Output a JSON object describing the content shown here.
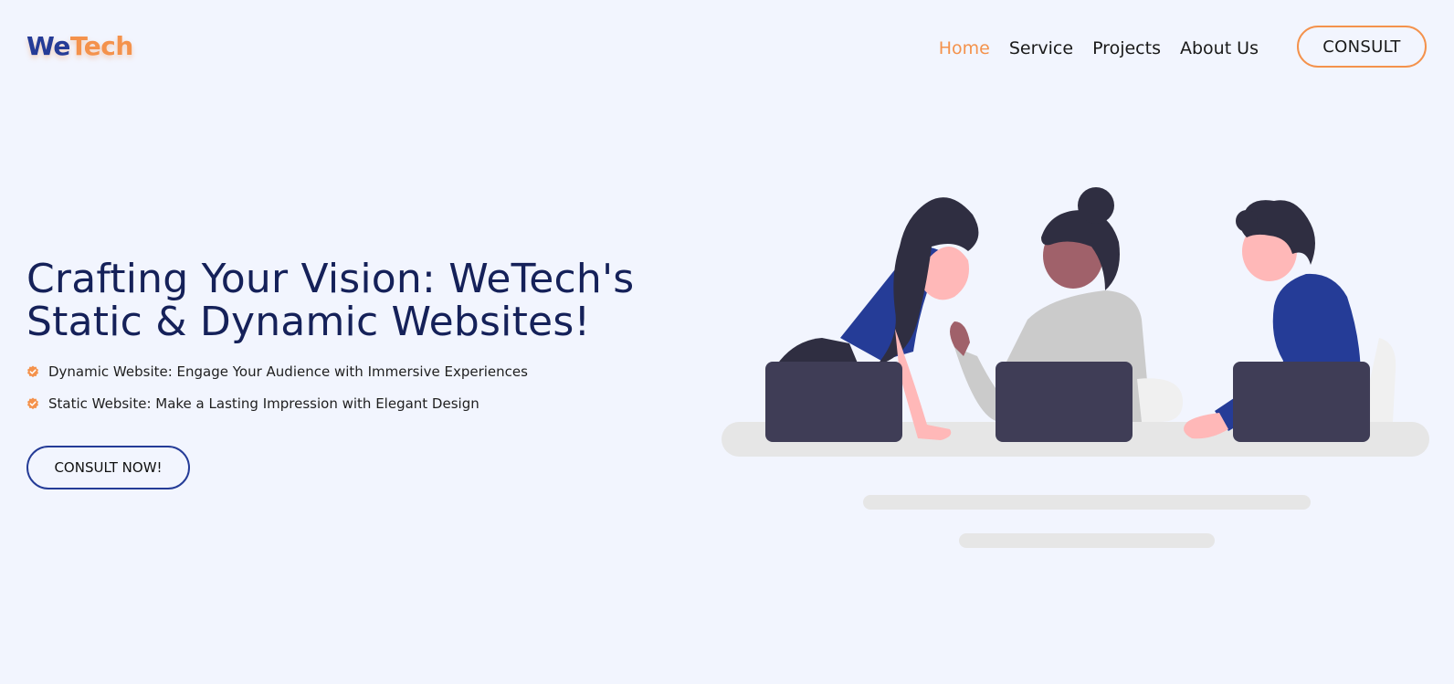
{
  "header": {
    "logo": {
      "part1": "We",
      "part2": "Tech"
    },
    "nav": [
      {
        "label": "Home",
        "active": true
      },
      {
        "label": "Service",
        "active": false
      },
      {
        "label": "Projects",
        "active": false
      },
      {
        "label": "About Us",
        "active": false
      }
    ],
    "cta_label": "CONSULT"
  },
  "hero": {
    "title_line1": "Crafting Your Vision: WeTech's",
    "title_line2": "Static & Dynamic Websites!",
    "features": [
      "Dynamic Website: Engage Your Audience with Immersive Experiences",
      "Static Website: Make a Lasting Impression with Elegant Design"
    ],
    "cta_label": "CONSULT NOW!",
    "feature_icon": "check-badge-icon",
    "illustration": "team-meeting-illustration"
  },
  "colors": {
    "background": "#f2f5fe",
    "brand_blue": "#253c97",
    "accent_orange": "#f4924c",
    "title_navy": "#152159"
  }
}
